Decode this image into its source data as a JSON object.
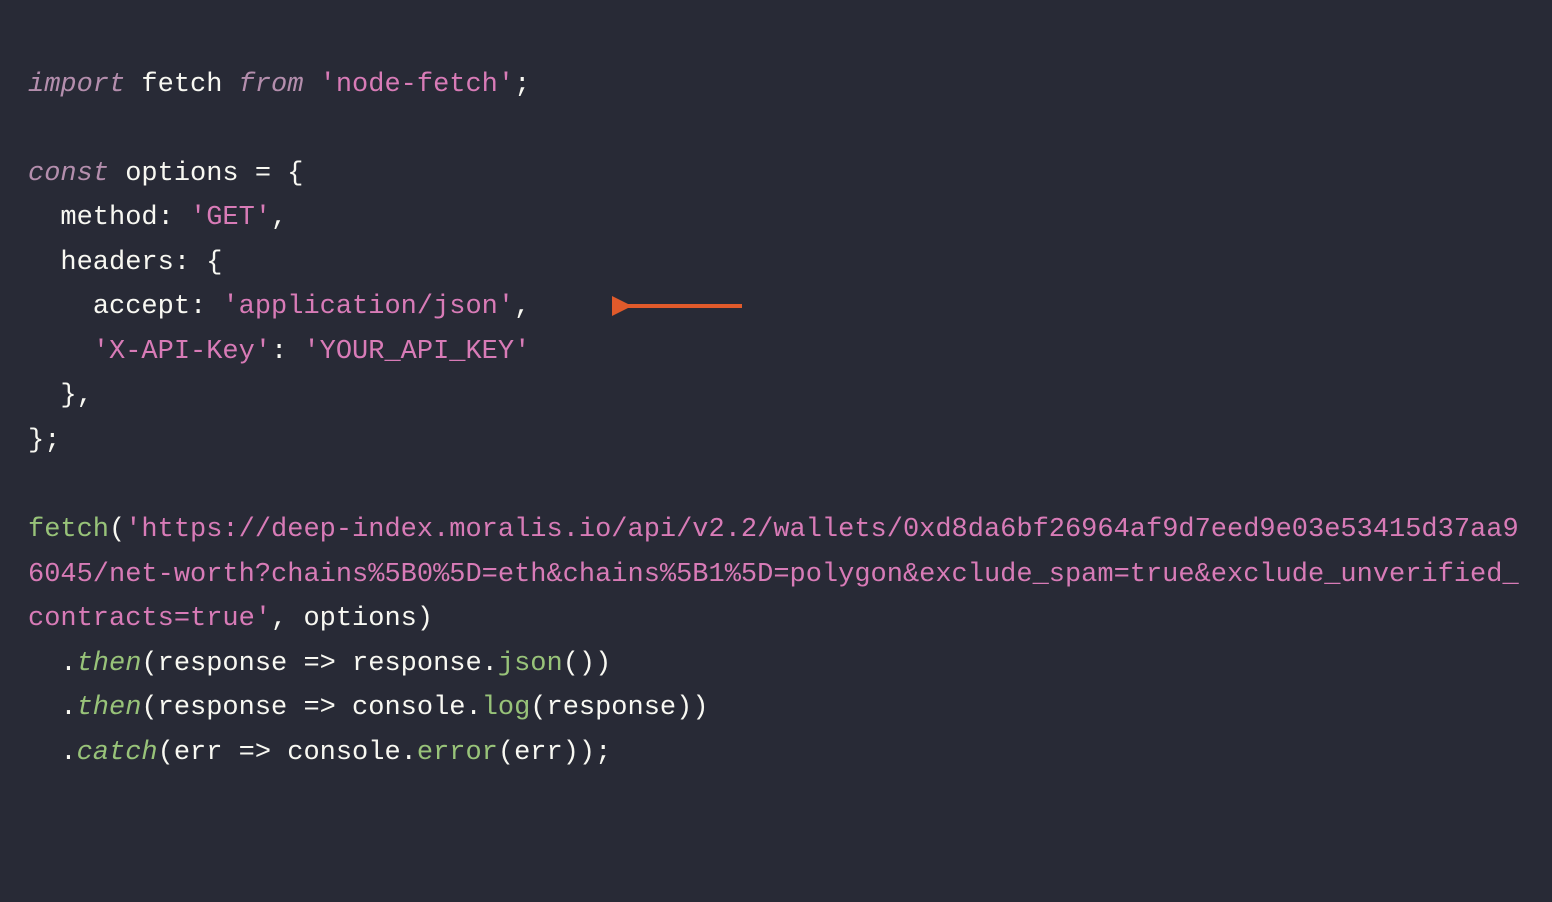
{
  "code": {
    "line1_import": "import",
    "line1_fetch": " fetch ",
    "line1_from": "from",
    "line1_module": " 'node-fetch'",
    "line1_end": ";",
    "line3_const": "const",
    "line3_options": " options ",
    "line3_eq": "=",
    "line3_brace": " {",
    "line4_indent": "  ",
    "line4_method": "method",
    "line4_colon": ": ",
    "line4_get": "'GET'",
    "line4_comma": ",",
    "line5_indent": "  ",
    "line5_headers": "headers",
    "line5_colon": ": {",
    "line6_indent": "    ",
    "line6_accept": "accept",
    "line6_colon": ": ",
    "line6_value": "'application/json'",
    "line6_comma": ",",
    "line7_indent": "    ",
    "line7_key": "'X-API-Key'",
    "line7_colon": ": ",
    "line7_value": "'YOUR_API_KEY'",
    "line8_indent": "  ",
    "line8_close": "},",
    "line9_close": "};",
    "line11_fetch": "fetch",
    "line11_open": "(",
    "line11_url": "'https://deep-index.moralis.io/api/v2.2/wallets/0xd8da6bf26964af9d7eed9e03e53415d37aa96045/net-worth?chains%5B0%5D=eth&chains%5B1%5D=polygon&exclude_spam=true&exclude_unverified_contracts=true'",
    "line11_rest": ", options)",
    "line12_indent": "  ",
    "line12_dot": ".",
    "line12_then": "then",
    "line12_arg": "(response ",
    "line12_arrow": "=>",
    "line12_body1": " response.",
    "line12_json": "json",
    "line12_tail": "())",
    "line13_indent": "  ",
    "line13_dot": ".",
    "line13_then": "then",
    "line13_arg": "(response ",
    "line13_arrow": "=>",
    "line13_body1": " console.",
    "line13_log": "log",
    "line13_tail": "(response))",
    "line14_indent": "  ",
    "line14_dot": ".",
    "line14_catch": "catch",
    "line14_arg": "(err ",
    "line14_arrow": "=>",
    "line14_body1": " console.",
    "line14_error": "error",
    "line14_tail": "(err));"
  },
  "annotation": {
    "arrow_color": "#e05a2b"
  }
}
